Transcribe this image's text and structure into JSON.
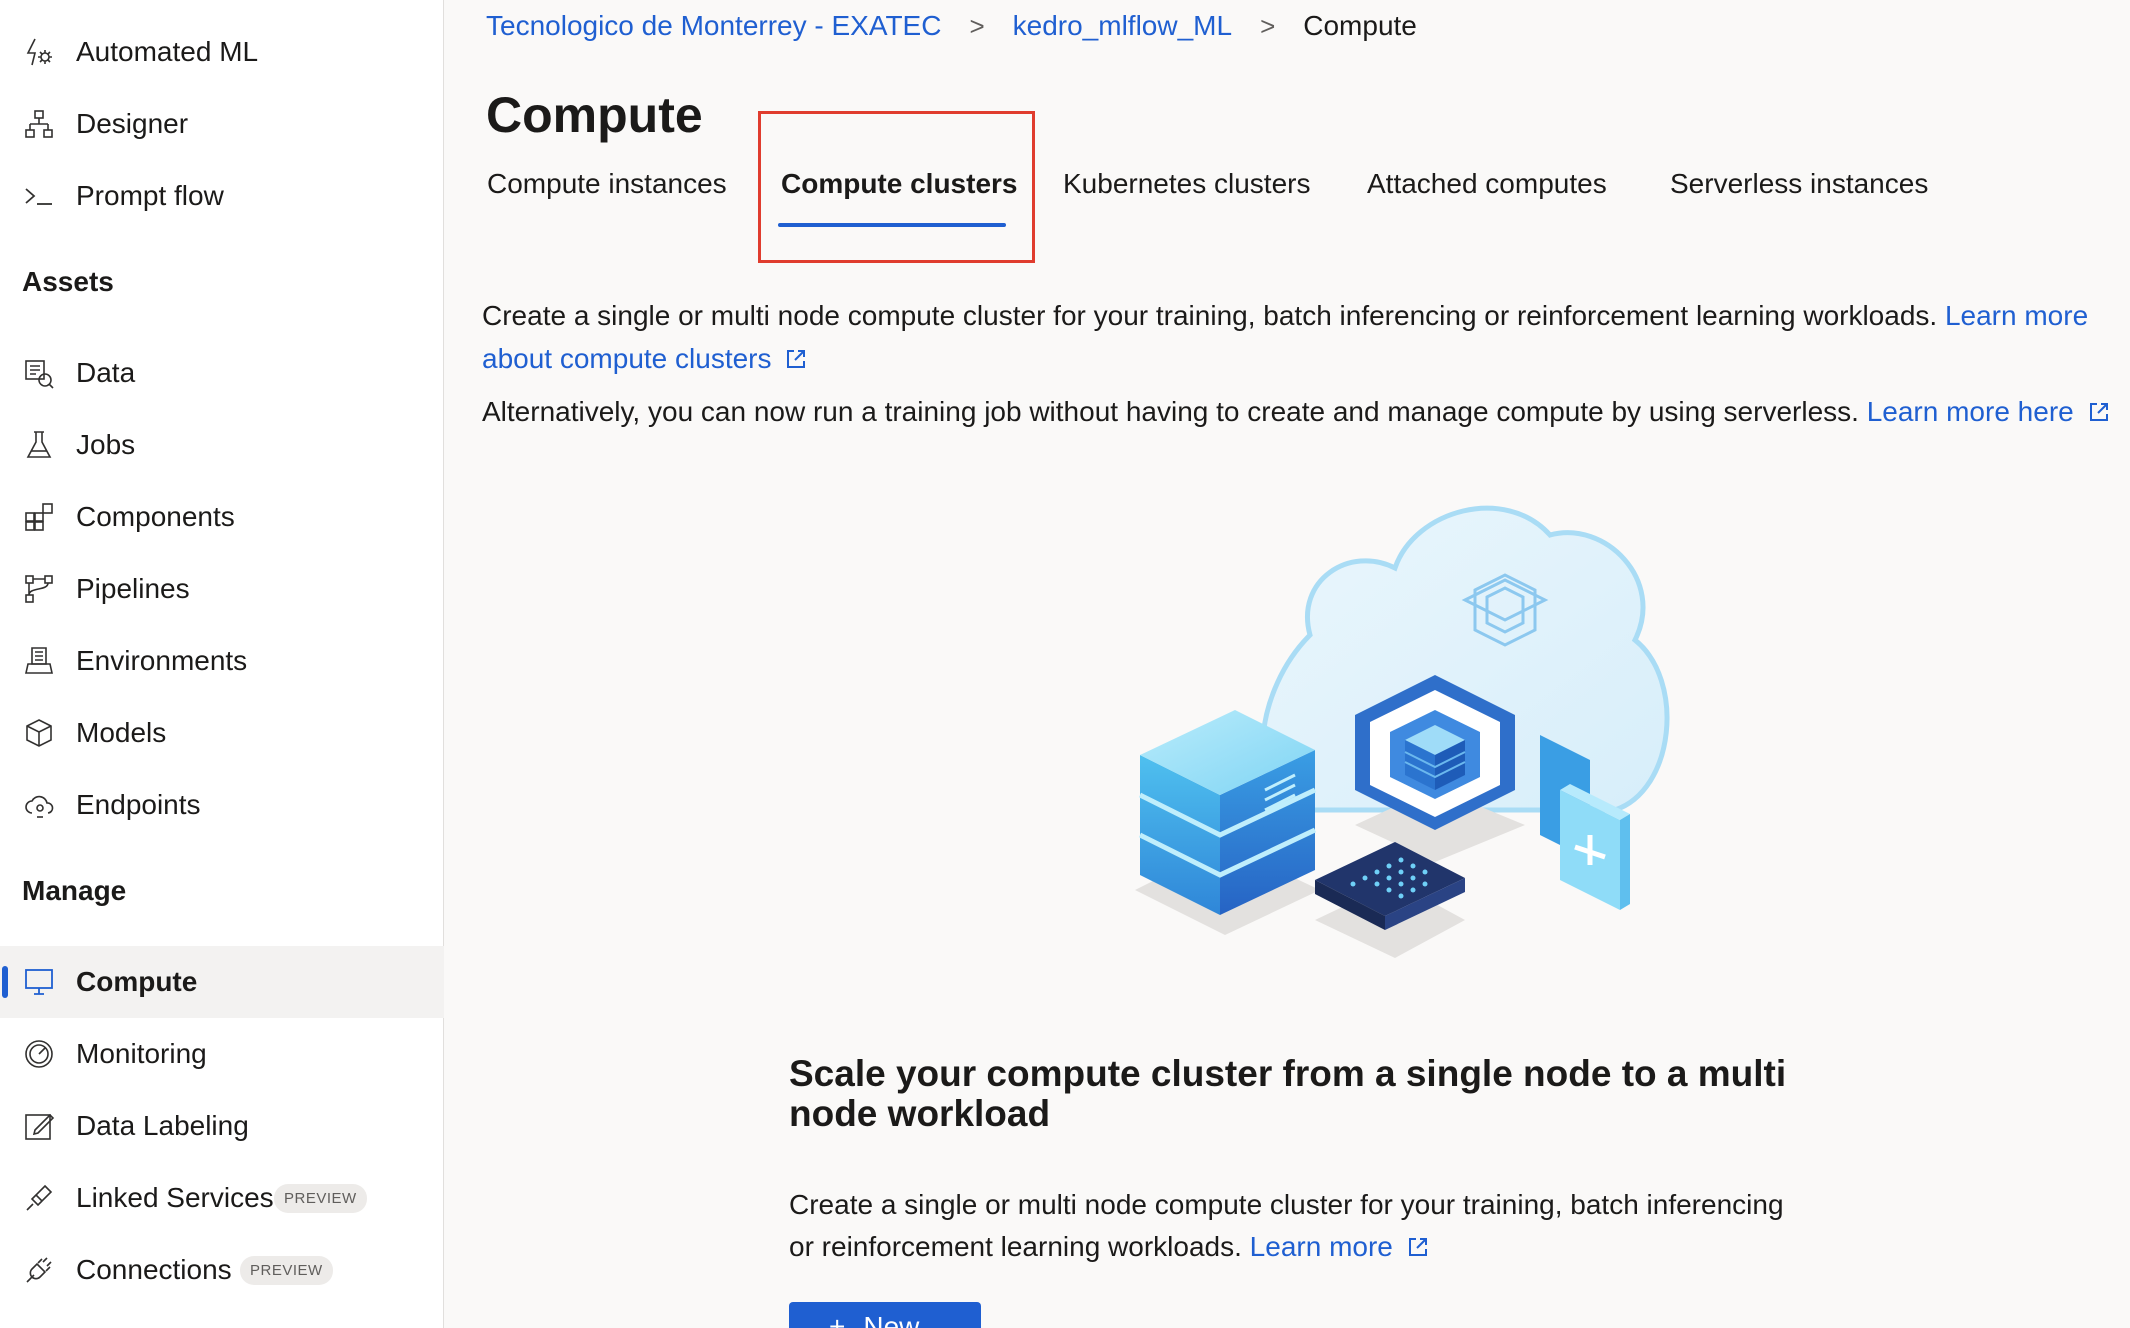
{
  "sidebar": {
    "top_items": [
      {
        "label": "Automated ML",
        "icon": "automated-ml-icon"
      },
      {
        "label": "Designer",
        "icon": "designer-icon"
      },
      {
        "label": "Prompt flow",
        "icon": "prompt-flow-icon"
      }
    ],
    "assets_heading": "Assets",
    "assets_items": [
      {
        "label": "Data",
        "icon": "data-icon"
      },
      {
        "label": "Jobs",
        "icon": "jobs-flask-icon"
      },
      {
        "label": "Components",
        "icon": "components-icon"
      },
      {
        "label": "Pipelines",
        "icon": "pipelines-icon"
      },
      {
        "label": "Environments",
        "icon": "environments-icon"
      },
      {
        "label": "Models",
        "icon": "models-cube-icon"
      },
      {
        "label": "Endpoints",
        "icon": "endpoints-cloud-icon"
      }
    ],
    "manage_heading": "Manage",
    "manage_items": [
      {
        "label": "Compute",
        "icon": "compute-monitor-icon",
        "active": true
      },
      {
        "label": "Monitoring",
        "icon": "monitoring-gauge-icon"
      },
      {
        "label": "Data Labeling",
        "icon": "data-labeling-icon"
      },
      {
        "label": "Linked Services",
        "icon": "linked-services-icon",
        "badge": "PREVIEW"
      },
      {
        "label": "Connections",
        "icon": "connections-plug-icon",
        "badge": "PREVIEW"
      }
    ]
  },
  "breadcrumb": {
    "items": [
      "Tecnologico de Monterrey - EXATEC",
      "kedro_mlflow_ML"
    ],
    "current": "Compute",
    "separator": ">"
  },
  "page": {
    "title": "Compute",
    "tabs": [
      {
        "label": "Compute instances",
        "active": false
      },
      {
        "label": "Compute clusters",
        "active": true
      },
      {
        "label": "Kubernetes clusters",
        "active": false
      },
      {
        "label": "Attached computes",
        "active": false
      },
      {
        "label": "Serverless instances",
        "active": false
      }
    ],
    "description": {
      "text": "Create a single or multi node compute cluster for your training, batch inferencing or reinforcement learning workloads.",
      "link_line1": "Learn more",
      "link_line2": "about compute clusters"
    },
    "alternative": {
      "text": "Alternatively, you can now run a training job without having to create and manage compute by using serverless.",
      "link": "Learn more here"
    },
    "card": {
      "title": "Scale your compute cluster from a single node to a multi node workload",
      "body": "Create a single or multi node compute cluster for your training, batch inferencing or reinforcement learning workloads.",
      "link": "Learn more",
      "button_icon": "plus-icon",
      "button_label": "New"
    }
  },
  "colors": {
    "accent": "#1f5fd1",
    "highlight_box": "#e03c2e"
  }
}
